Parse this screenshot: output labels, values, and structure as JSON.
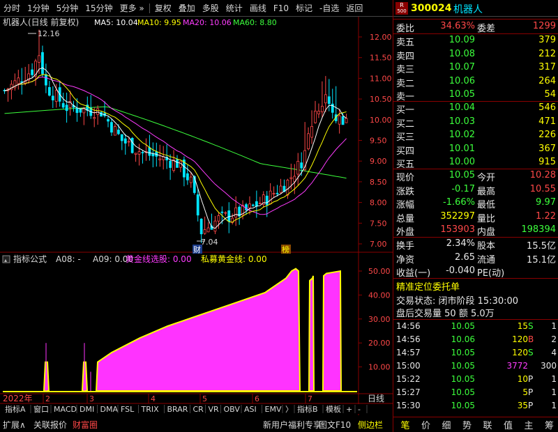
{
  "toolbar": {
    "items": [
      "分时",
      "1分钟",
      "5分钟",
      "15分钟",
      "更多",
      "复权",
      "叠加",
      "多股",
      "统计",
      "画线",
      "F10",
      "标记",
      "-自选",
      "返回"
    ]
  },
  "main_chart": {
    "title": "机器人(日线 前复权)",
    "ma_labels": [
      {
        "text": "MA5: 10.04",
        "color": "#ffffff"
      },
      {
        "text": "MA10: 9.95",
        "color": "#ffff00"
      },
      {
        "text": "MA20: 10.06",
        "color": "#ff3cff"
      },
      {
        "text": "MA60: 8.80",
        "color": "#3cff3c"
      }
    ],
    "high_label": "12.16",
    "low_label": "7.04",
    "marker_cai": "财",
    "marker_bang": "榜",
    "y_ticks": [
      "12.00",
      "11.50",
      "11.00",
      "10.50",
      "10.00",
      "9.50",
      "9.00",
      "8.50",
      "8.00",
      "7.50",
      "7.00"
    ]
  },
  "indicator": {
    "title": "指标公式",
    "a08": "A08: -",
    "a09": "A09: 0.00",
    "huangjin": "黄金线选股: 0.00",
    "simu": "私募黄金线: 0.00",
    "y_ticks": [
      "50.00",
      "40.00",
      "30.00",
      "20.00",
      "10.00"
    ]
  },
  "xaxis": {
    "year": "2022年",
    "months": [
      "2",
      "3",
      "4",
      "5",
      "6",
      "7"
    ],
    "right_label": "日线"
  },
  "tabs_row1": [
    "指标A",
    "窗口",
    "MACD",
    "DMI",
    "DMA",
    "FSL",
    "TRIX",
    "BRAR",
    "CR",
    "VR",
    "OBV",
    "ASI",
    "EMV",
    "〉",
    "指标B",
    "模板",
    "+",
    "-"
  ],
  "tabs_row2": {
    "left": [
      "扩展∧",
      "关联报价",
      "财富圈"
    ],
    "right": [
      "新用户福利专享",
      "图文F10",
      "侧边栏"
    ]
  },
  "quote": {
    "badge_top": "R",
    "badge_bottom": "500",
    "code": "300024",
    "name": "机器人",
    "webi_label": "委比",
    "webi_value": "34.63%",
    "weicha_label": "委差",
    "weicha_value": "1299",
    "sells": [
      {
        "label": "卖五",
        "price": "10.09",
        "vol": "379"
      },
      {
        "label": "卖四",
        "price": "10.08",
        "vol": "212"
      },
      {
        "label": "卖三",
        "price": "10.07",
        "vol": "317"
      },
      {
        "label": "卖二",
        "price": "10.06",
        "vol": "264"
      },
      {
        "label": "卖一",
        "price": "10.05",
        "vol": "54"
      }
    ],
    "buys": [
      {
        "label": "买一",
        "price": "10.04",
        "vol": "546"
      },
      {
        "label": "买二",
        "price": "10.03",
        "vol": "471"
      },
      {
        "label": "买三",
        "price": "10.02",
        "vol": "226"
      },
      {
        "label": "买四",
        "price": "10.01",
        "vol": "367"
      },
      {
        "label": "买五",
        "price": "10.00",
        "vol": "915"
      }
    ],
    "stats": [
      {
        "l1": "现价",
        "v1": "10.05",
        "c1": "green",
        "l2": "今开",
        "v2": "10.28",
        "c2": "red"
      },
      {
        "l1": "涨跌",
        "v1": "-0.17",
        "c1": "green",
        "l2": "最高",
        "v2": "10.55",
        "c2": "red"
      },
      {
        "l1": "涨幅",
        "v1": "-1.66%",
        "c1": "green",
        "l2": "最低",
        "v2": "9.97",
        "c2": "green"
      },
      {
        "l1": "总量",
        "v1": "352297",
        "c1": "yellow",
        "l2": "量比",
        "v2": "1.22",
        "c2": "red"
      },
      {
        "l1": "外盘",
        "v1": "153903",
        "c1": "red",
        "l2": "内盘",
        "v2": "198394",
        "c2": "green"
      }
    ],
    "stats2": [
      {
        "l1": "换手",
        "v1": "2.34%",
        "l2": "股本",
        "v2": "15.5亿"
      },
      {
        "l1": "净资",
        "v1": "2.65",
        "l2": "流通",
        "v2": "15.1亿"
      },
      {
        "l1": "收益(一)",
        "v1": "-0.040",
        "l2": "PE(动)",
        "v2": ""
      }
    ],
    "precise_title": "精准定位委托单",
    "trade_state": "交易状态: 闭市阶段 15:30:00",
    "after_hours": "盘后交易量 50 额 5.0万",
    "ticks": [
      {
        "t": "14:56",
        "p": "10.05",
        "v": "15",
        "vc": "yellow",
        "s": "S",
        "sc": "green",
        "n": "1"
      },
      {
        "t": "14:56",
        "p": "10.06",
        "v": "120",
        "vc": "yellow",
        "s": "B",
        "sc": "red",
        "n": "2"
      },
      {
        "t": "14:57",
        "p": "10.05",
        "v": "120",
        "vc": "yellow",
        "s": "S",
        "sc": "green",
        "n": "4"
      },
      {
        "t": "15:00",
        "p": "10.05",
        "v": "3772",
        "vc": "magenta",
        "s": "",
        "sc": "white",
        "n": "300"
      },
      {
        "t": "15:22",
        "p": "10.05",
        "v": "10",
        "vc": "yellow",
        "s": "P",
        "sc": "white",
        "n": "1"
      },
      {
        "t": "15:27",
        "p": "10.05",
        "v": "5",
        "vc": "yellow",
        "s": "P",
        "sc": "white",
        "n": "1"
      },
      {
        "t": "15:30",
        "p": "10.05",
        "v": "35",
        "vc": "yellow",
        "s": "P",
        "sc": "white",
        "n": "1"
      }
    ],
    "bottom_tabs": [
      "笔",
      "价",
      "细",
      "势",
      "联",
      "值",
      "主",
      "筹"
    ]
  }
}
